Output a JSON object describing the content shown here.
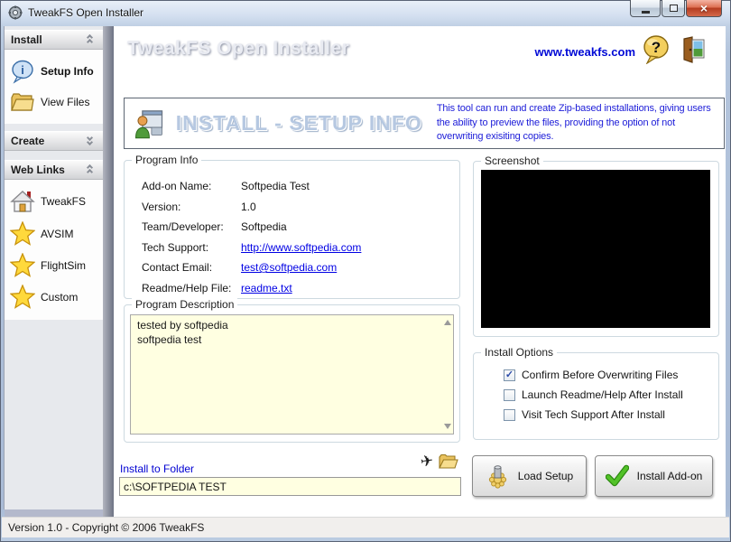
{
  "titlebar": {
    "title": "TweakFS Open Installer"
  },
  "header": {
    "title": "TweakFS Open Installer",
    "website": "www.tweakfs.com"
  },
  "sidebar": {
    "sections": [
      {
        "label": "Install",
        "state": "expanded",
        "items": [
          {
            "label": "Setup Info"
          },
          {
            "label": "View Files"
          }
        ]
      },
      {
        "label": "Create",
        "state": "collapsed",
        "items": []
      },
      {
        "label": "Web Links",
        "state": "expanded",
        "items": [
          {
            "label": "TweakFS"
          },
          {
            "label": "AVSIM"
          },
          {
            "label": "FlightSim"
          },
          {
            "label": "Custom"
          }
        ]
      }
    ]
  },
  "banner": {
    "title": "INSTALL - SETUP INFO",
    "description": "This tool can run and create Zip-based installations, giving users the ability to preview the files, providing the option of not overwriting exisiting copies."
  },
  "program_info": {
    "title": "Program Info",
    "rows": [
      {
        "label": "Add-on Name:",
        "value": "Softpedia Test"
      },
      {
        "label": "Version:",
        "value": "1.0"
      },
      {
        "label": "Team/Developer:",
        "value": "Softpedia"
      },
      {
        "label": "Tech Support:",
        "value": "http://www.softpedia.com"
      },
      {
        "label": "Contact Email:",
        "value": "test@softpedia.com"
      },
      {
        "label": "Readme/Help File:",
        "value": "readme.txt"
      }
    ]
  },
  "screenshot": {
    "title": "Screenshot"
  },
  "program_description": {
    "title": "Program Description",
    "text": "tested by softpedia\nsoftpedia test"
  },
  "install_options": {
    "title": "Install Options",
    "options": [
      {
        "label": "Confirm Before Overwriting Files",
        "checked": true,
        "mark": "✓"
      },
      {
        "label": "Launch Readme/Help After Install",
        "checked": false,
        "mark": ""
      },
      {
        "label": "Visit Tech Support After Install",
        "checked": false,
        "mark": ""
      }
    ]
  },
  "folder": {
    "label": "Install to Folder",
    "value": "c:\\SOFTPEDIA TEST"
  },
  "actions": {
    "load_setup": "Load Setup",
    "install_addon": "Install Add-on"
  },
  "statusbar": {
    "text": "Version 1.0 - Copyright © 2006 TweakFS"
  },
  "icons": {
    "app": "gear",
    "help_q": "?",
    "exit": "open-door-picture",
    "plane": "✈",
    "setup_info": "info-balloon",
    "view_files": "folder",
    "tweakfs": "home",
    "avsim": "star",
    "flightsim": "star",
    "custom": "star",
    "banner": "setup-person-window",
    "load_setup": "gold-gear-cylinder",
    "install_addon": "green-check",
    "close_x": "×"
  },
  "colors": {
    "link_blue": "#0000e4",
    "field_yellow": "#ffffe1",
    "banner_text_blue": "#1c1cd8",
    "close_red": "#b43b20"
  }
}
